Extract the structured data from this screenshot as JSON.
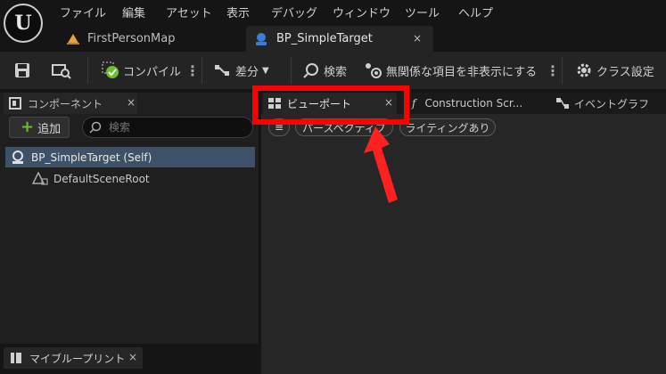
{
  "menu": [
    "ファイル",
    "編集",
    "アセット",
    "表示",
    "デバッグ",
    "ウィンドウ",
    "ツール",
    "ヘルプ"
  ],
  "tabs": {
    "map": "FirstPersonMap",
    "blueprint": "BP_SimpleTarget",
    "close": "×"
  },
  "toolbar": {
    "compile": "コンパイル",
    "diff": "差分",
    "search": "検索",
    "hide_unrelated": "無関係な項目を非表示にする",
    "class_settings": "クラス設定",
    "more": "⋮"
  },
  "components_panel": {
    "title": "コンポーネント",
    "add_label": "追加",
    "search_placeholder": "検索",
    "items": [
      "BP_SimpleTarget (Self)",
      "DefaultSceneRoot"
    ]
  },
  "my_blueprint_panel": {
    "title": "マイブループリント"
  },
  "editor_tabs": {
    "viewport": "ビューポート",
    "construction": "Construction Scr...",
    "event_graph": "イベントグラフ"
  },
  "viewport_toolbar": {
    "perspective": "パースペクティブ",
    "lighting": "ライティングあり"
  },
  "colors": {
    "highlight": "#ff0000",
    "selected_row": "#3d5168",
    "compile_check": "#6abf2a"
  }
}
